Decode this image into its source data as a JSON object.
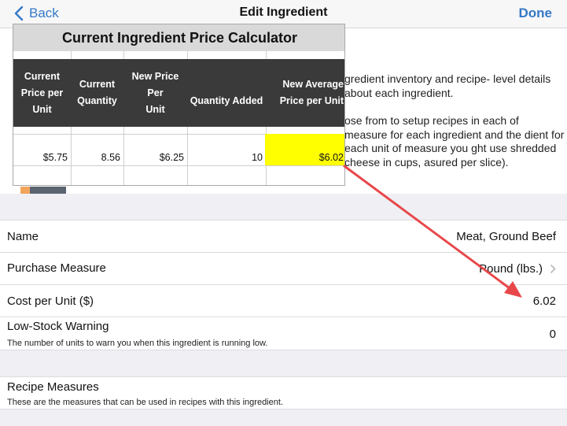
{
  "navbar": {
    "back_label": "Back",
    "title": "Edit Ingredient",
    "done_label": "Done"
  },
  "help": {
    "para1": "gredient inventory and recipe- level details about each ingredient.",
    "para2": "ose from to setup recipes in each of measure for each ingredient and the dient for each unit of measure you ght use shredded cheese in cups, asured per slice)."
  },
  "form": {
    "name_label": "Name",
    "name_value": "Meat, Ground Beef",
    "purchase_label": "Purchase Measure",
    "purchase_value": "Pound (lbs.)",
    "cost_label": "Cost per Unit ($)",
    "cost_value": "6.02",
    "lowstock_label": "Low-Stock Warning",
    "lowstock_sub": "The number of units to warn you when this ingredient is running low.",
    "lowstock_value": "0",
    "recipe_label": "Recipe Measures",
    "recipe_sub": "These are the measures that can be used in recipes with this ingredient."
  },
  "calculator": {
    "title": "Current Ingredient Price Calculator",
    "headers": [
      [
        "Current",
        "Price per",
        "Unit"
      ],
      [
        "Current",
        "Quantity"
      ],
      [
        "New Price Per",
        "Unit"
      ],
      [
        "Quantity Added"
      ],
      [
        "New Average",
        "Price per Unit"
      ]
    ],
    "values": [
      "$5.75",
      "8.56",
      "$6.25",
      "10",
      "$6.02"
    ],
    "highlight_color": "#ffff00"
  },
  "colors": {
    "accent": "#3478c6",
    "arrow": "#e8474a"
  }
}
